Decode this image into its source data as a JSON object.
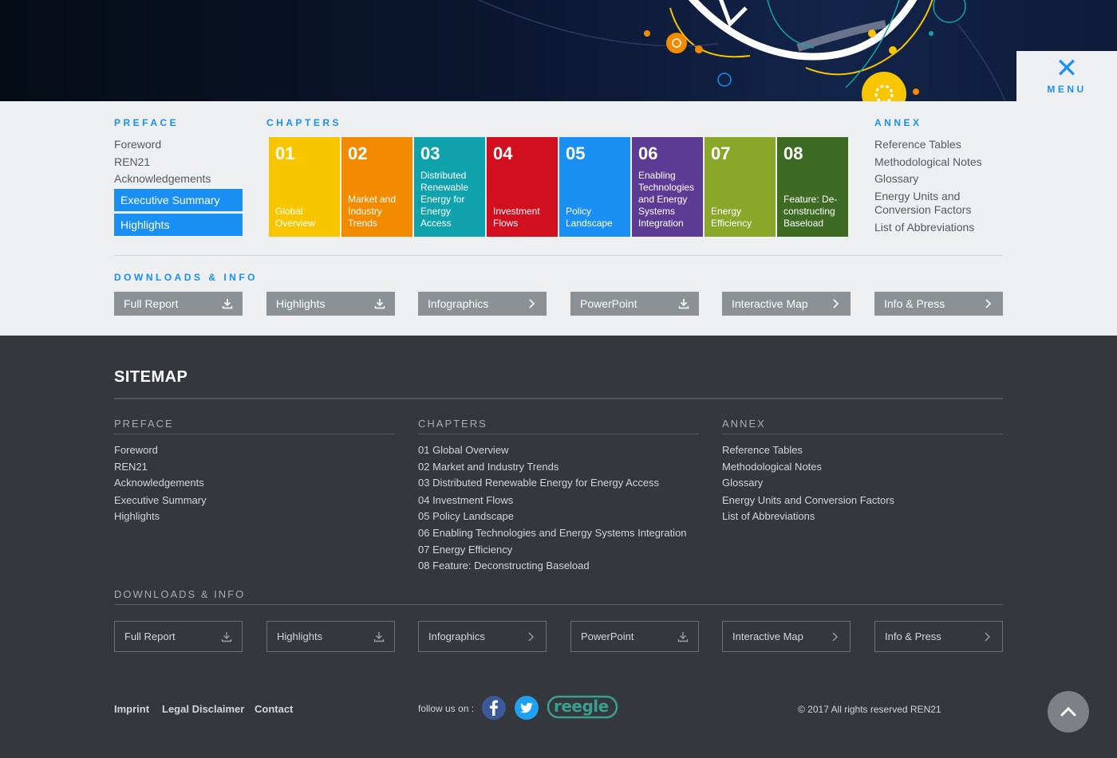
{
  "menu": {
    "close_symbol": "✕",
    "label": "MENU"
  },
  "preface": {
    "title": "PREFACE",
    "links": [
      "Foreword",
      "REN21",
      "Acknowledgements"
    ],
    "highlighted": [
      "Executive Summary",
      "Highlights"
    ]
  },
  "chapters": {
    "title": "CHAPTERS",
    "items": [
      {
        "number": "01",
        "name": "Global Overview",
        "color": "#f7c600"
      },
      {
        "number": "02",
        "name": "Market and Industry Trends",
        "color": "#f28b00"
      },
      {
        "number": "03",
        "name": "Distributed Renewable Energy for Energy Access",
        "color": "#11a3ad"
      },
      {
        "number": "04",
        "name": "Investment Flows",
        "color": "#d10f1e"
      },
      {
        "number": "05",
        "name": "Policy Landscape",
        "color": "#1a8ff4"
      },
      {
        "number": "06",
        "name": "Enabling Technologies and Energy Systems Integration",
        "color": "#5d3b94"
      },
      {
        "number": "07",
        "name": "Energy Efficiency",
        "color": "#8aa72a"
      },
      {
        "number": "08",
        "name": "Feature: De-constructing Baseload",
        "color": "#3e6b23"
      }
    ]
  },
  "annex": {
    "title": "ANNEX",
    "links": [
      "Reference Tables",
      "Methodological Notes",
      "Glossary",
      "Energy Units and Conversion Factors",
      "List of Abbreviations"
    ]
  },
  "downloads": {
    "title": "DOWNLOADS & INFO",
    "items": [
      {
        "label": "Full Report",
        "icon": "download-icon"
      },
      {
        "label": "Highlights",
        "icon": "download-icon"
      },
      {
        "label": "Infographics",
        "icon": "chevron-right-icon"
      },
      {
        "label": "PowerPoint",
        "icon": "download-icon"
      },
      {
        "label": "Interactive Map",
        "icon": "chevron-right-icon"
      },
      {
        "label": "Info & Press",
        "icon": "chevron-right-icon"
      }
    ]
  },
  "sitemap": {
    "title": "SITEMAP",
    "preface_title": "PREFACE",
    "preface_links": [
      "Foreword",
      "REN21",
      "Acknowledgements",
      "Executive Summary",
      "Highlights"
    ],
    "chapters_title": "CHAPTERS",
    "chapter_links": [
      "01 Global Overview",
      "02 Market and Industry Trends",
      "03 Distributed Renewable Energy for Energy Access",
      "04 Investment Flows",
      "05 Policy Landscape",
      "06 Enabling Technologies and Energy Systems Integration",
      "07 Energy Efficiency",
      "08 Feature: Deconstructing Baseload"
    ],
    "annex_title": "ANNEX",
    "annex_links": [
      "Reference Tables",
      "Methodological Notes",
      "Glossary",
      "Energy Units and Conversion Factors",
      "List of Abbreviations"
    ],
    "downloads_title": "DOWNLOADS & INFO"
  },
  "footer": {
    "links": [
      "Imprint",
      "Legal Disclaimer",
      "Contact"
    ],
    "follow_label": "follow us on :",
    "social": [
      "facebook-icon",
      "twitter-icon",
      "reegle-logo"
    ],
    "reegle_text": "reegle",
    "copyright": "© 2017 All rights reserved REN21"
  }
}
